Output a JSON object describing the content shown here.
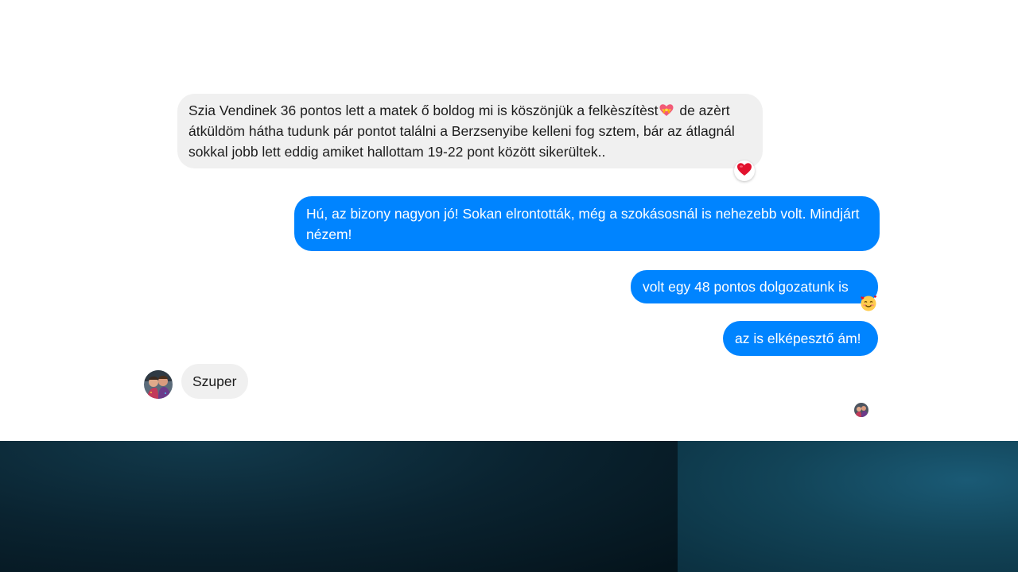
{
  "conversation": {
    "messages": [
      {
        "direction": "incoming",
        "text_part1": "Szia Vendinek 36 pontos lett a matek ő boldog mi is köszönjük a felkèszítèst",
        "inline_emoji": "heart-with-ribbon",
        "text_part2": " de azèrt átküldöm hátha tudunk pár pontot találni a Berzsenyibe kelleni fog  sztem, bár az átlagnál sokkal jobb lett eddig amiket hallottam 19-22 pont között sikerültek..",
        "reaction": "red-heart"
      },
      {
        "direction": "outgoing",
        "text": "Hú, az bizony nagyon jó! Sokan elrontották, még a szokásosnál is nehezebb volt. Mindjárt nézem!"
      },
      {
        "direction": "outgoing",
        "text": "volt egy 48 pontos dolgozatunk is",
        "reaction": "smiling-face-with-hearts"
      },
      {
        "direction": "outgoing",
        "text": "az is elképesztő ám!"
      },
      {
        "direction": "incoming",
        "text": "Szuper"
      }
    ]
  },
  "colors": {
    "outgoing_bubble": "#0084ff",
    "incoming_bubble": "#f0f0f0",
    "background_bottom": "#0b2d3d"
  },
  "icons": {
    "reaction1": "red-heart-icon",
    "reaction2": "smiling-face-with-hearts-icon",
    "avatar": "user-avatar",
    "seen_indicator": "seen-avatar"
  }
}
